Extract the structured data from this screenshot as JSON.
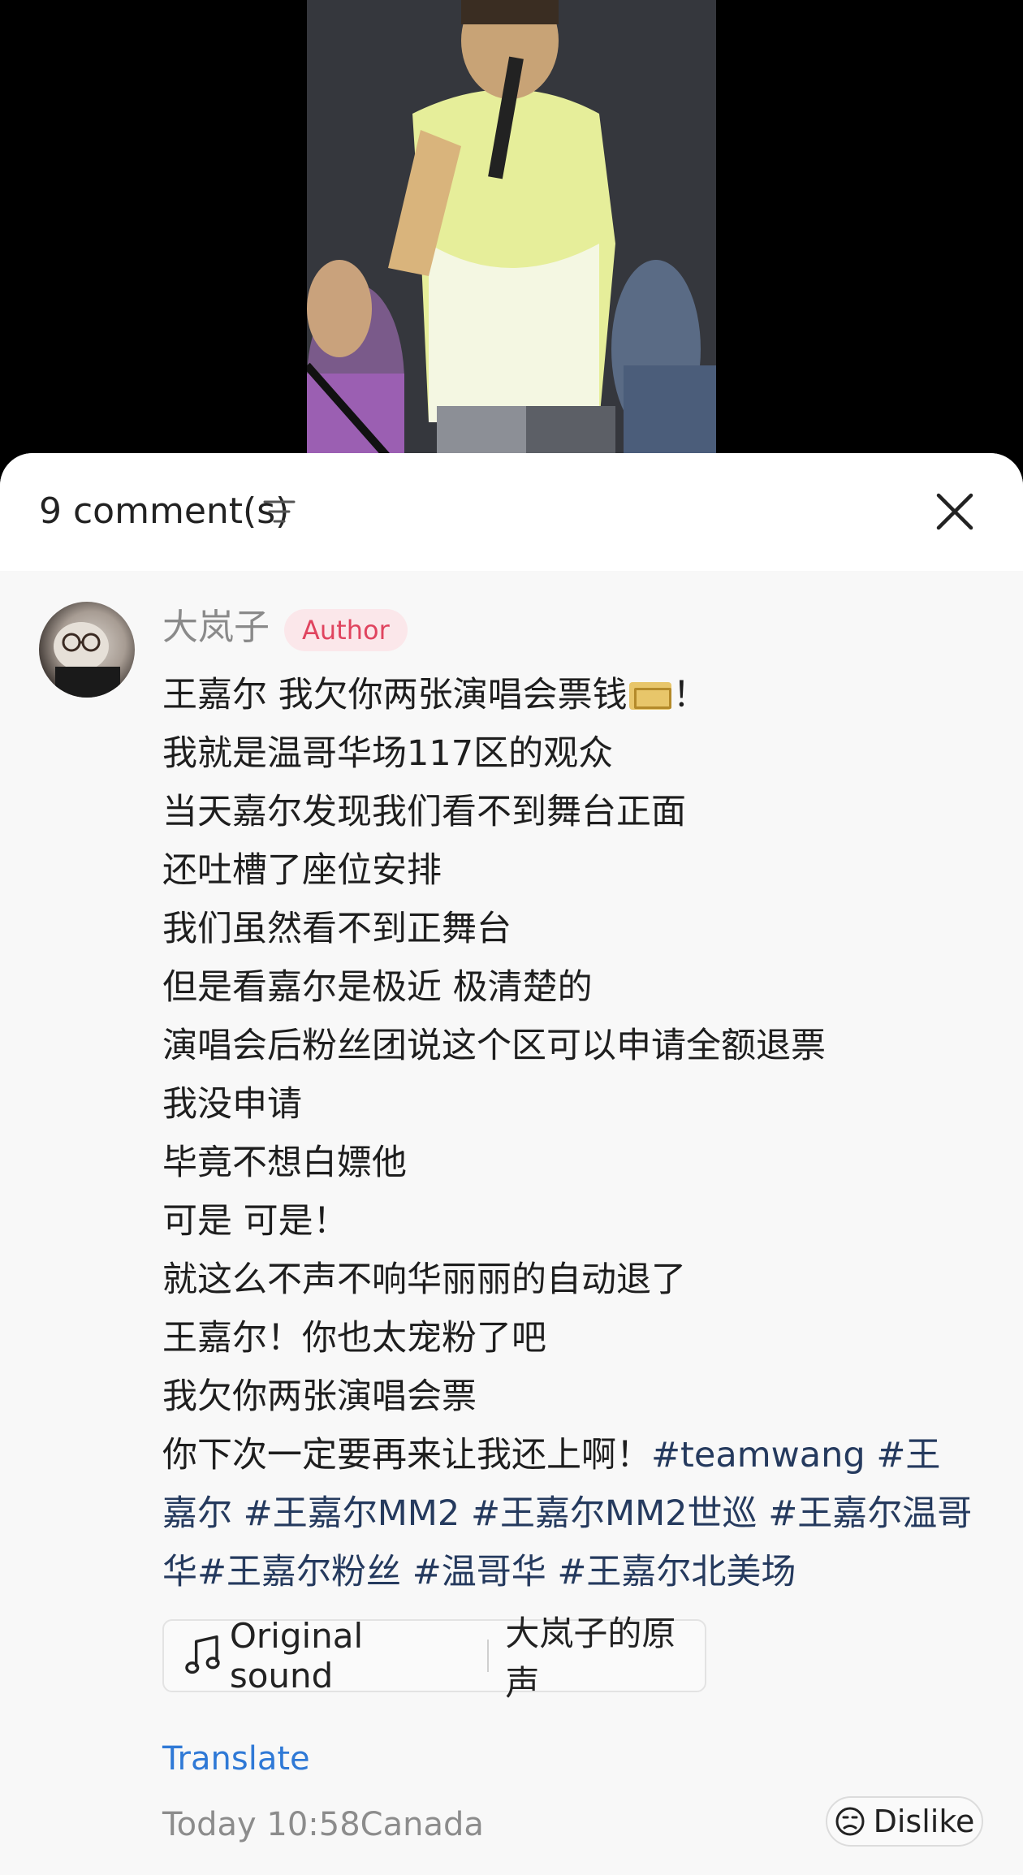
{
  "header": {
    "comment_count": "9 comment(s)"
  },
  "comment": {
    "username": "大岚子",
    "badge": "Author",
    "lines": {
      "l1a": "王嘉尔 我欠你两张演唱会票钱",
      "l1b": "！",
      "l2": "我就是温哥华场117区的观众",
      "l3": "当天嘉尔发现我们看不到舞台正面",
      "l4": "还吐槽了座位安排",
      "l5": "我们虽然看不到正舞台",
      "l6": "但是看嘉尔是极近 极清楚的",
      "l7": "演唱会后粉丝团说这个区可以申请全额退票",
      "l8": "我没申请",
      "l9": "毕竟不想白嫖他",
      "l10": "可是 可是！",
      "l11": "就这么不声不响华丽丽的自动退了",
      "l12": "王嘉尔！你也太宠粉了吧",
      "l13": "我欠你两张演唱会票",
      "l14": "你下次一定要再来让我还上啊！"
    },
    "hashtags": {
      "h1": "#teamwang",
      "h2": "#王嘉尔",
      "h3": "#王嘉尔MM2",
      "h4": "#王嘉尔MM2世巡",
      "h5": "#王嘉尔温哥华",
      "h6": "#王嘉尔粉丝",
      "h7": "#温哥华",
      "h8": "#王嘉尔北美场"
    }
  },
  "sound": {
    "label": "Original sound",
    "owner": "大岚子的原声"
  },
  "actions": {
    "translate": "Translate",
    "dislike": "Dislike"
  },
  "meta": {
    "timestamp": "Today 10:58Canada"
  },
  "colors": {
    "hashtag": "#253a5e",
    "badge_text": "#e0445f",
    "badge_bg": "#fbe7ea",
    "link": "#2f79d6"
  },
  "icons": [
    "sort-icon",
    "close-icon",
    "music-note-icon",
    "dislike-face-icon",
    "ticket-emoji-icon"
  ]
}
